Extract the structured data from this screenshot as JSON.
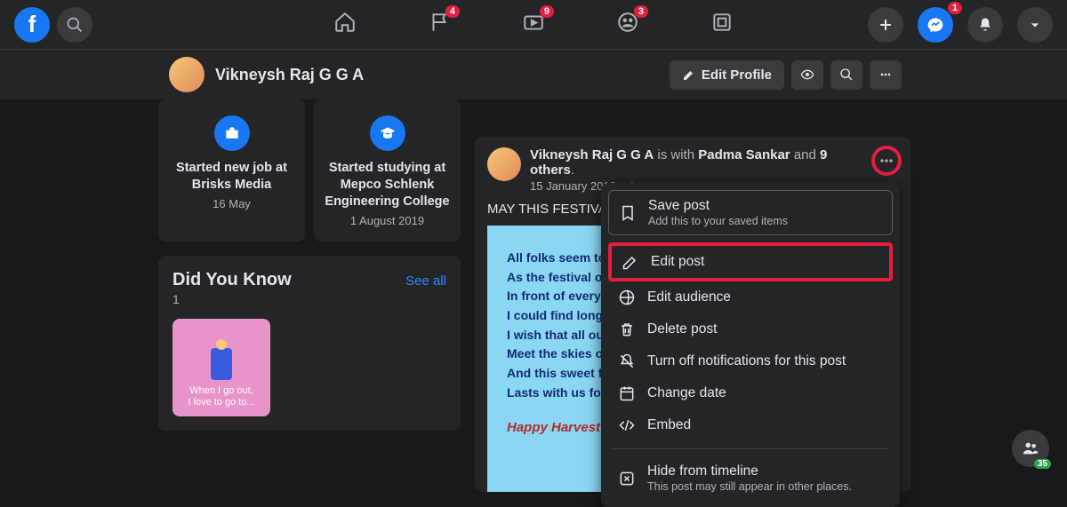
{
  "topbar": {
    "badges": {
      "pages": "4",
      "watch": "9",
      "groups": "3",
      "messenger": "1"
    }
  },
  "profile": {
    "name": "Vikneysh Raj G G A",
    "edit_label": "Edit Profile"
  },
  "life_events": [
    {
      "title_l1": "Started new job at",
      "title_l2": "Brisks Media",
      "date": "16 May"
    },
    {
      "title_l1": "Started studying at",
      "title_l2": "Mepco Schlenk Engineering College",
      "date": "1 August 2019"
    }
  ],
  "dyk": {
    "title": "Did You Know",
    "see_all": "See all",
    "count": "1",
    "tile_text_l1": "When I go out,",
    "tile_text_l2": "I love to go to..."
  },
  "post": {
    "author": "Vikneysh Raj G G A",
    "with_text": " is with ",
    "tagged": "Padma Sankar",
    "and_text": " and ",
    "others": "9 others",
    "date": "15 January 2019",
    "body": "MAY THIS FESTIVA",
    "poem": [
      "All folks seem to",
      "As the festival of",
      "In front of every",
      "I could find long",
      "I wish that all ou",
      "Meet the skies o",
      "And this sweet  f",
      "Lasts with us for"
    ],
    "banner": "Happy Harvest f"
  },
  "menu": {
    "save": {
      "label": "Save post",
      "sub": "Add this to your saved items"
    },
    "edit": "Edit post",
    "audience": "Edit audience",
    "delete": "Delete post",
    "notifications": "Turn off notifications for this post",
    "change_date": "Change date",
    "embed": "Embed",
    "hide": {
      "label": "Hide from timeline",
      "sub": "This post may still appear in other places."
    }
  },
  "friends_count": "35"
}
